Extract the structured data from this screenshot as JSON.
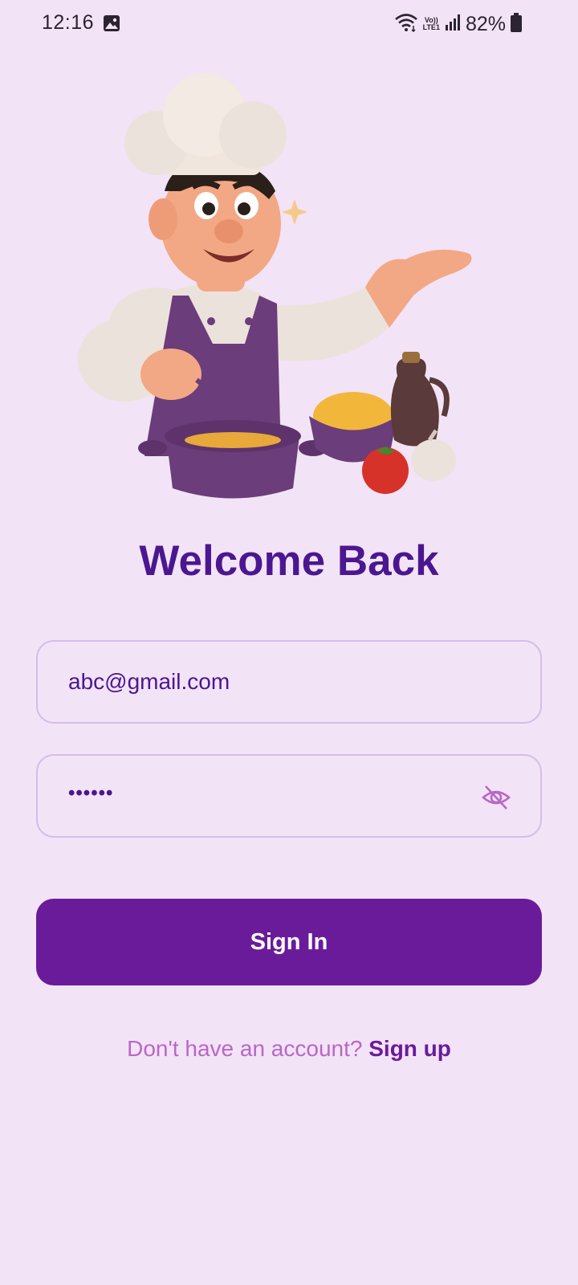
{
  "status_bar": {
    "time": "12:16",
    "battery": "82%",
    "volte_top": "Vo))",
    "volte_bottom": "LTE1",
    "icons": [
      "image-icon",
      "wifi-icon",
      "volte-icon",
      "signal-icon",
      "battery-icon"
    ]
  },
  "hero": {
    "icon": "chef-cooking-illustration"
  },
  "title": "Welcome Back",
  "form": {
    "email_value": "abc@gmail.com",
    "password_mask": "••••••",
    "password_toggle_icon": "eye-off-icon",
    "signin_label": "Sign In"
  },
  "footer": {
    "prompt": "Don't have an account?",
    "signup_label": "Sign up"
  },
  "colors": {
    "background": "#f3e3f6",
    "primary": "#6a1b9a",
    "title": "#4a1791",
    "field_border": "#d4bde9",
    "prompt": "#b967c8"
  }
}
